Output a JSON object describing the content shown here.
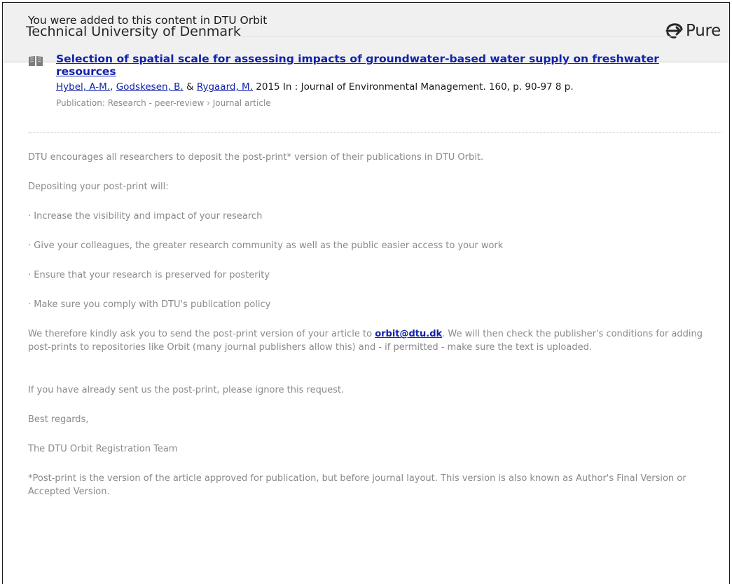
{
  "header": {
    "org_name": "Technical University of Denmark",
    "logo_text": "Pure",
    "logo_icon": "pure-logo-icon"
  },
  "intro": "You were added to this content in DTU Orbit",
  "publication": {
    "icon": "book-icon",
    "title": "Selection of spatial scale for assessing impacts of groundwater-based water supply on freshwater resources",
    "authors": [
      {
        "name": "Hybel, A-M."
      },
      {
        "name": "Godskesen, B."
      },
      {
        "name": "Rygaard, M."
      }
    ],
    "sep_comma": ", ",
    "sep_amp": " & ",
    "details": " 2015 In : Journal of Environmental Management. 160, p. 90-97 8 p.",
    "breadcrumb": "Publication: Research - peer-review › Journal article"
  },
  "body": {
    "p1": "DTU encourages all researchers to deposit the post-print* version of their publications in DTU Orbit.",
    "p2": "Depositing your post-print will:",
    "bullets": [
      "· Increase the visibility and impact of your research",
      "· Give your colleagues, the greater research community as well as the public easier access to your work",
      "· Ensure that your research is preserved for posterity",
      "· Make sure you comply with DTU's publication policy"
    ],
    "request_before": "We therefore kindly ask you to send the post-print version of your article to ",
    "email": "orbit@dtu.dk",
    "request_after": ". We will then check the publisher's conditions for adding post-prints to repositories like Orbit (many journal publishers allow this) and - if permitted - make sure the text is uploaded.",
    "ignore_note": "If you have already sent us the post-print, please ignore this request.",
    "regards": "Best regards,",
    "team": "The DTU Orbit Registration Team",
    "footnote": "*Post-print is the version of the article approved for publication, but before journal layout. This version is also known as Author's Final Version or Accepted Version."
  },
  "colors": {
    "link": "#1122aa",
    "muted_text": "#8a8a8a",
    "header_bg": "#f0f0f0"
  }
}
